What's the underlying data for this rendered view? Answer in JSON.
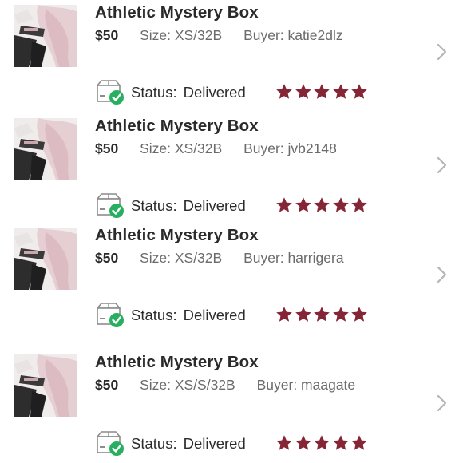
{
  "colors": {
    "star": "#852637",
    "check": "#27ae60",
    "chevron": "#b5b5b5",
    "text_primary": "#2a2a2a",
    "text_secondary": "#6b6b6b"
  },
  "orders": [
    {
      "title": "Athletic Mystery Box",
      "price": "$50",
      "size": "Size: XS/32B",
      "buyer": "Buyer: katie2dlz",
      "status_label": "Status:",
      "status_value": "Delivered",
      "rating": 5,
      "thumbnail_icon": "product-photo",
      "status_icon": "package-delivered-icon",
      "nav_icon": "chevron-right-icon"
    },
    {
      "title": "Athletic Mystery Box",
      "price": "$50",
      "size": "Size: XS/32B",
      "buyer": "Buyer: jvb2148",
      "status_label": "Status:",
      "status_value": "Delivered",
      "rating": 5,
      "thumbnail_icon": "product-photo",
      "status_icon": "package-delivered-icon",
      "nav_icon": "chevron-right-icon"
    },
    {
      "title": "Athletic Mystery Box",
      "price": "$50",
      "size": "Size: XS/32B",
      "buyer": "Buyer: harrigera",
      "status_label": "Status:",
      "status_value": "Delivered",
      "rating": 5,
      "thumbnail_icon": "product-photo",
      "status_icon": "package-delivered-icon",
      "nav_icon": "chevron-right-icon"
    },
    {
      "title": "Athletic Mystery Box",
      "price": "$50",
      "size": "Size: XS/S/32B",
      "buyer": "Buyer: maagate",
      "status_label": "Status:",
      "status_value": "Delivered",
      "rating": 5,
      "thumbnail_icon": "product-photo",
      "status_icon": "package-delivered-icon",
      "nav_icon": "chevron-right-icon"
    }
  ]
}
